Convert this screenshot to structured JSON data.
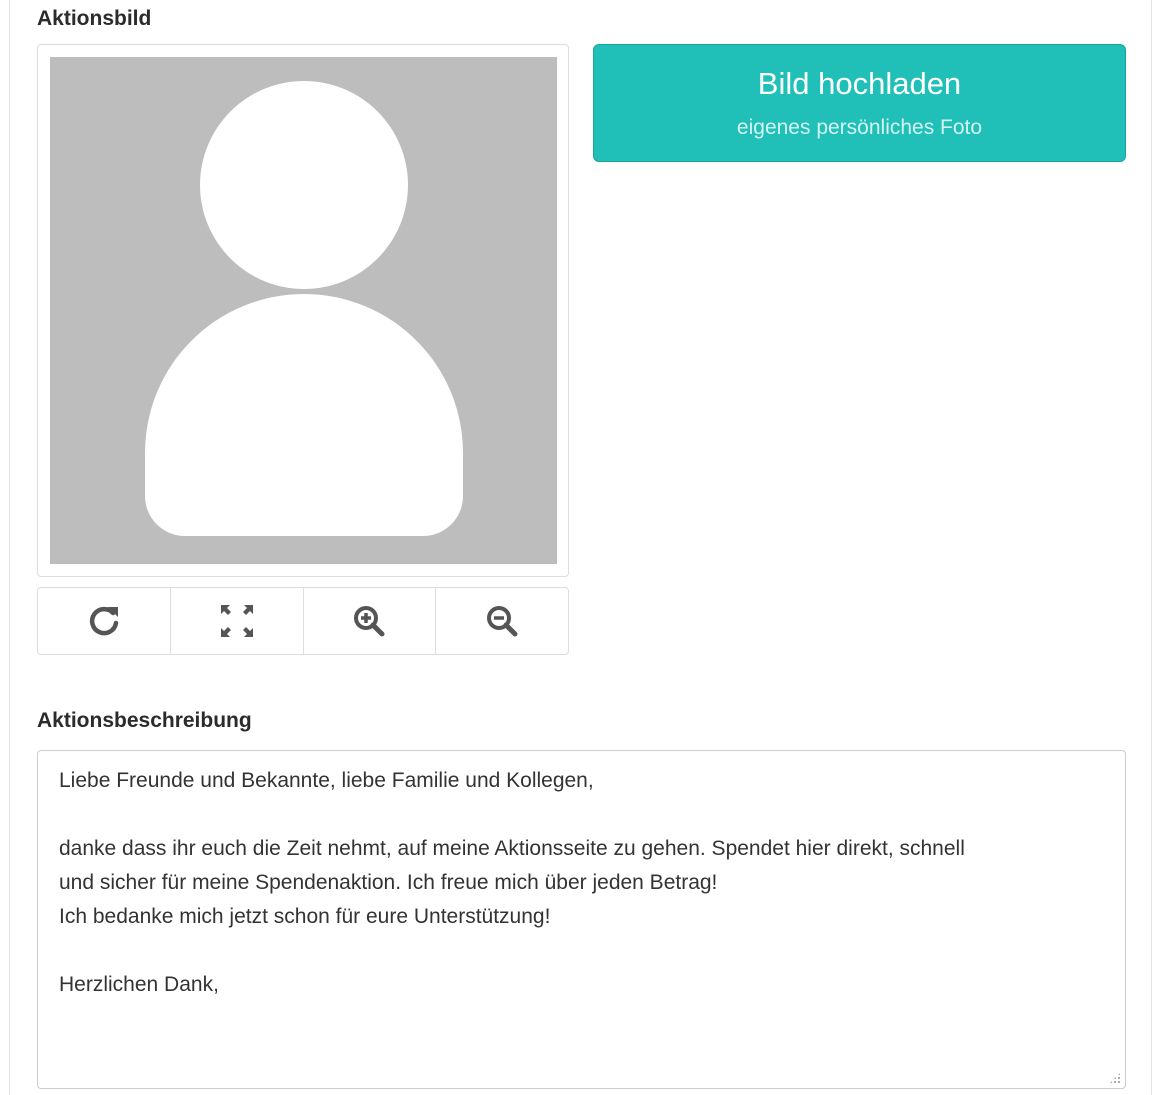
{
  "image_section": {
    "label": "Aktionsbild",
    "placeholder_icon": "person-avatar-placeholder",
    "tools": [
      {
        "name": "rotate",
        "icon": "rotate-icon"
      },
      {
        "name": "fit",
        "icon": "expand-arrows-icon"
      },
      {
        "name": "zoom-in",
        "icon": "zoom-in-icon"
      },
      {
        "name": "zoom-out",
        "icon": "zoom-out-icon"
      }
    ]
  },
  "upload": {
    "title": "Bild hochladen",
    "subtitle": "eigenes persönliches Foto",
    "color": "#20bfb8"
  },
  "description": {
    "label": "Aktionsbeschreibung",
    "lines": [
      "Liebe Freunde und Bekannte, liebe Familie und Kollegen,",
      "",
      "danke dass ihr euch die Zeit nehmt, auf meine Aktionsseite zu gehen. Spendet hier direkt, schnell",
      "und sicher für meine Spendenaktion. Ich freue mich über jeden Betrag!",
      "Ich bedanke mich jetzt schon für eure Unterstützung!",
      "",
      "Herzlichen Dank,"
    ]
  }
}
